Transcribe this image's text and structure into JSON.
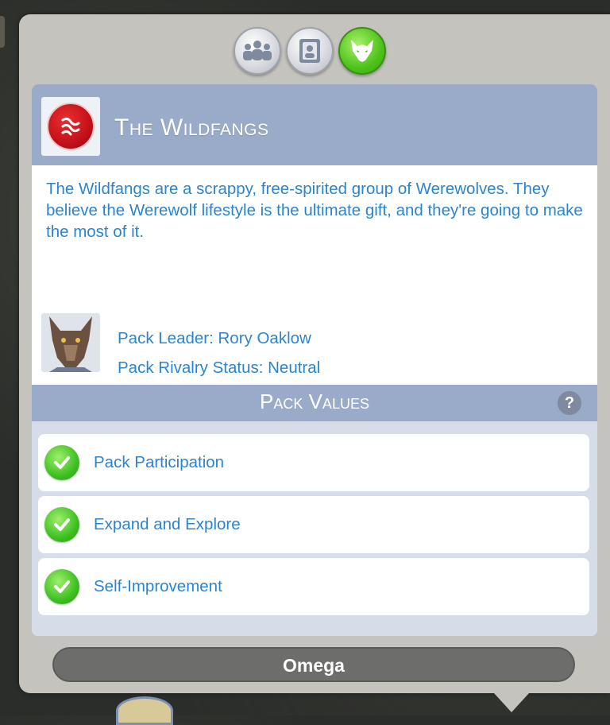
{
  "tabs": [
    {
      "name": "group-icon",
      "active": false
    },
    {
      "name": "portrait-frame-icon",
      "active": false
    },
    {
      "name": "wolf-icon",
      "active": true
    }
  ],
  "pack": {
    "name": "The Wildfangs",
    "icon": "claw-marks-icon",
    "description": "The Wildfangs are a scrappy, free-spirited group of Werewolves. They believe the Werewolf lifestyle is the ultimate gift, and they're going to make the most of it.",
    "leader_line": "Pack Leader: Rory Oaklow",
    "rivalry_line": "Pack Rivalry Status: Neutral"
  },
  "values": {
    "title": "Pack Values",
    "help": "?",
    "items": [
      {
        "label": "Pack Participation",
        "checked": true
      },
      {
        "label": "Expand and Explore",
        "checked": true
      },
      {
        "label": "Self-Improvement",
        "checked": true
      }
    ]
  },
  "rank": "Omega",
  "colors": {
    "text_blue": "#2a85cf",
    "header_blue": "#9aabc9",
    "active_green": "#4fc31c",
    "pack_red": "#c4101a"
  }
}
